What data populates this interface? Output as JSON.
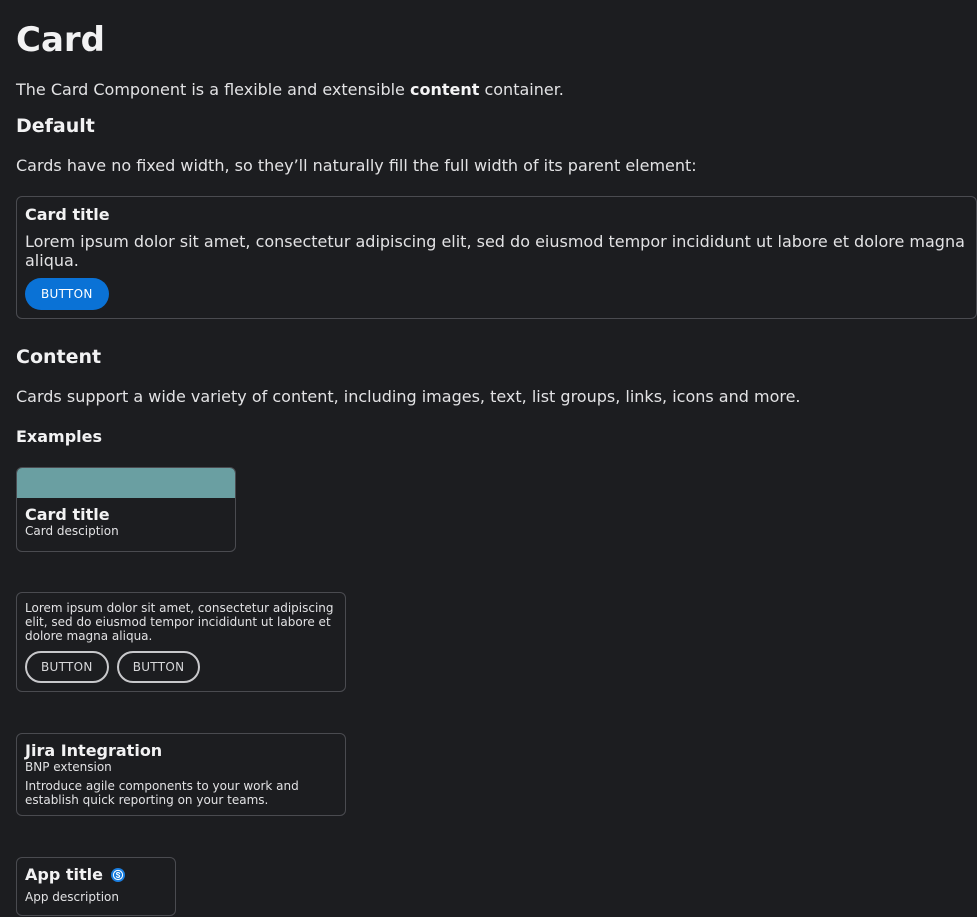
{
  "page": {
    "title": "Card",
    "intro_before": "The Card Component is a flexible and extensible ",
    "intro_bold": "content",
    "intro_after": " container."
  },
  "default_section": {
    "heading": "Default",
    "text": "Cards have no fixed width, so they’ll naturally fill the full width of its parent element:",
    "card": {
      "title": "Card title",
      "body": "Lorem ipsum dolor sit amet, consectetur adipiscing elit, sed do eiusmod tempor incididunt ut labore et dolore magna aliqua.",
      "button_label": "BUTTON"
    }
  },
  "content_section": {
    "heading": "Content",
    "text": "Cards support a wide variety of content, including images, text, list groups, links, icons and more.",
    "examples_heading": "Examples",
    "media_card": {
      "title": "Card title",
      "description": "Card desciption",
      "media_color": "#6a9fa2"
    },
    "text_card": {
      "body": "Lorem ipsum dolor sit amet, consectetur adipiscing elit, sed do eiusmod tempor incididunt ut labore et dolore magna aliqua.",
      "button1_label": "BUTTON",
      "button2_label": "BUTTON"
    },
    "jira_card": {
      "title": "Jira Integration",
      "subtitle": "BNP extension",
      "body": "Introduce agile components to your work and establish quick reporting on your teams."
    },
    "app_card": {
      "title": "App title",
      "icon": "s-badge-icon",
      "description": "App description"
    }
  },
  "colors": {
    "background": "#1c1d20",
    "primary": "#0a72d6",
    "border": "#4a4b50"
  }
}
